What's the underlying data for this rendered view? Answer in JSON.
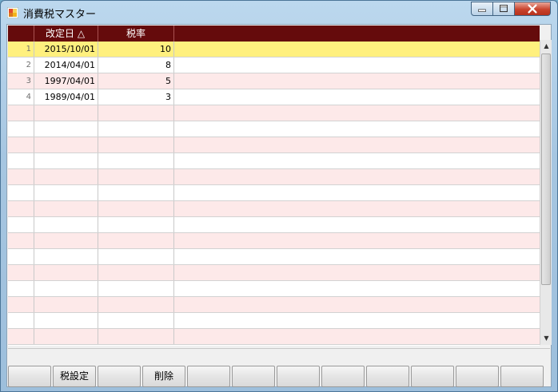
{
  "window": {
    "title": "消費税マスター"
  },
  "grid": {
    "columns": {
      "date": "改定日 △",
      "rate": "税率"
    },
    "rows": [
      {
        "num": "1",
        "date": "2015/10/01",
        "rate": "10"
      },
      {
        "num": "2",
        "date": "2014/04/01",
        "rate": "8"
      },
      {
        "num": "3",
        "date": "1997/04/01",
        "rate": "5"
      },
      {
        "num": "4",
        "date": "1989/04/01",
        "rate": "3"
      }
    ],
    "selected_row": 1
  },
  "buttons": [
    "",
    "税設定",
    "",
    "削除",
    "",
    "",
    "",
    "",
    "",
    "",
    "",
    ""
  ],
  "colors": {
    "header_bg": "#650b0c",
    "selected_row": "#fff07e",
    "alt_row": "#fde9e9"
  }
}
